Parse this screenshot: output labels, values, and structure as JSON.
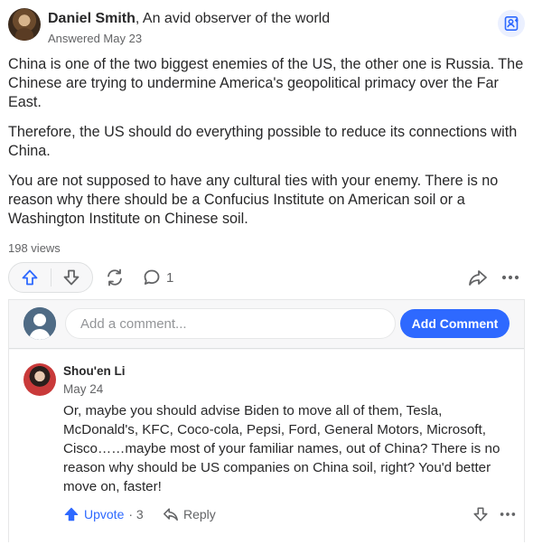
{
  "answer": {
    "author": {
      "name": "Daniel Smith",
      "credential": ", An avid observer of the world",
      "answered": "Answered May 23"
    },
    "paragraphs": [
      "China is one of the two biggest enemies of the US, the other one is Russia. The Chinese are trying to undermine America's geopolitical primacy over the Far East.",
      "Therefore, the US should do everything possible to reduce its connections with China.",
      "You are not supposed to have any cultural ties with your enemy. There is no reason why there should be a Confucius Institute on American soil or a Washington Institute on Chinese soil."
    ],
    "views": "198 views",
    "comment_count": "1"
  },
  "comments": {
    "input_placeholder": "Add a comment...",
    "add_button": "Add Comment",
    "items": [
      {
        "author": "Shou'en Li",
        "date": "May 24",
        "text": "Or, maybe you should advise Biden to move all of them, Tesla, McDonald's, KFC, Coco-cola, Pepsi, Ford, General Motors, Microsoft, Cisco……maybe most of your familiar names, out of China? There is no reason why should be US companies on China soil, right? You'd better move on, faster!",
        "upvote_label": "Upvote",
        "upvote_count": "· 3",
        "reply_label": "Reply"
      }
    ]
  },
  "colors": {
    "accent": "#2e69ff",
    "text": "#282829",
    "muted": "#636466",
    "panel": "#f7f7f8"
  }
}
